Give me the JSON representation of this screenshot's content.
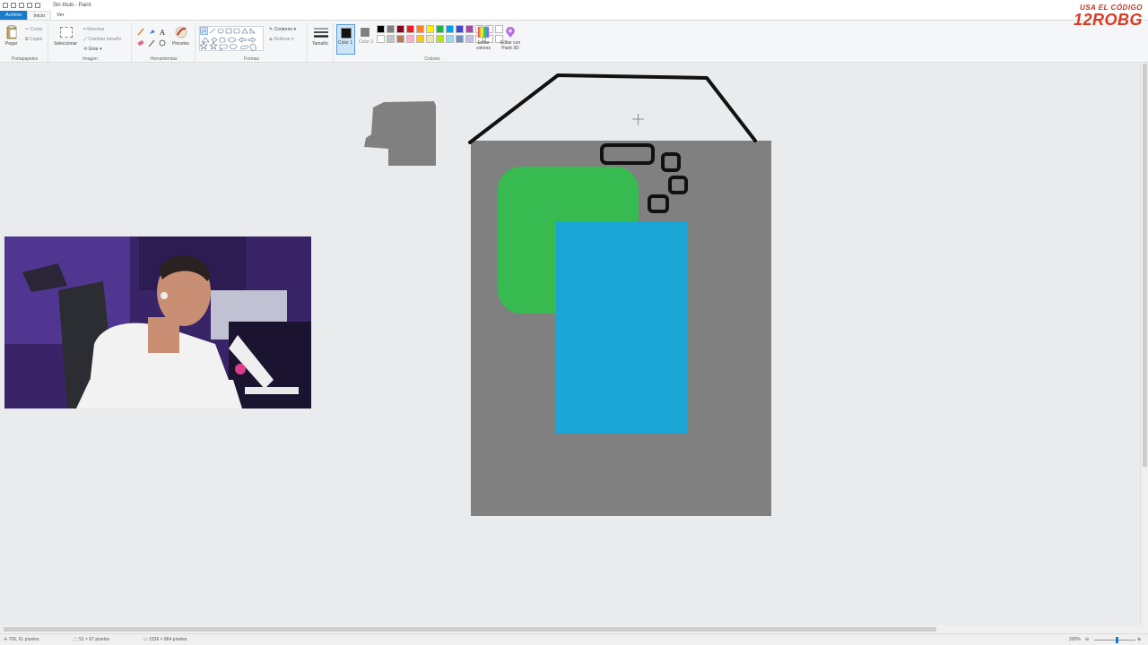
{
  "window": {
    "title": "Sin título - Paint"
  },
  "menu": {
    "file": "Archivo",
    "home": "Inicio",
    "view": "Ver"
  },
  "ribbon": {
    "clipboard": {
      "paste": "Pegar",
      "cut": "Cortar",
      "copy": "Copiar",
      "label": "Portapapeles"
    },
    "image": {
      "select": "Seleccionar",
      "crop": "Recortar",
      "resize": "Cambiar tamaño",
      "rotate": "Girar",
      "label": "Imagen"
    },
    "tools": {
      "label": "Herramientas",
      "brushes": "Pinceles"
    },
    "shapes": {
      "outline": "Contorno",
      "fill": "Rellenar",
      "label": "Formas"
    },
    "size": {
      "label": "Tamaño"
    },
    "colors": {
      "color1": "Color 1",
      "color2": "Color 2",
      "edit": "Editar colores",
      "paint3d": "Editar con Paint 3D",
      "label": "Colores",
      "color1_value": "#111111",
      "color2_value": "#7f7f7f",
      "palette_row1": [
        "#000000",
        "#7f7f7f",
        "#880015",
        "#ed1c24",
        "#ff7f27",
        "#fff200",
        "#22b14c",
        "#00a2e8",
        "#3f48cc",
        "#a349a4"
      ],
      "palette_row2": [
        "#ffffff",
        "#c3c3c3",
        "#b97a57",
        "#ffaec9",
        "#ffc90e",
        "#efe4b0",
        "#b5e61d",
        "#99d9ea",
        "#7092be",
        "#c8bfe7"
      ]
    }
  },
  "canvas": {
    "background": "#808080",
    "green_color": "#37bb50",
    "blue_color": "#1ba7d6",
    "stroke_color": "#111111"
  },
  "overlay": {
    "brand_small": "USA EL CÓDIGO",
    "brand_big": "12ROBG"
  },
  "status": {
    "cursor": "709, 61 píxeles",
    "selection": "51 × 67 píxeles",
    "size": "1536 × 864 píxeles",
    "zoom": "200%"
  }
}
